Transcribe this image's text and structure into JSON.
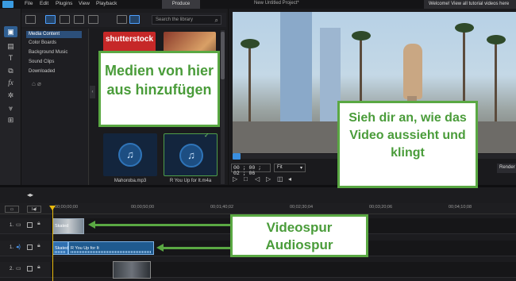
{
  "titlebar": {
    "menu": [
      "File",
      "Edit",
      "Plugins",
      "View",
      "Playback"
    ],
    "produce_label": "Produce",
    "project_title": "New Untitled Project*",
    "welcome_text": "Welcome! View all tutorial videos here"
  },
  "left_toolbar": {
    "tools": [
      "media-room",
      "pip-room",
      "title-room",
      "transition-room",
      "effect-room",
      "particle-room",
      "audio-mixing-room",
      "subtitle-room"
    ]
  },
  "media_room": {
    "search_placeholder": "Search the library",
    "categories": [
      "Media Content",
      "Color Boards",
      "Background Music",
      "Sound Clips",
      "Downloaded"
    ],
    "selected_category": "Media Content",
    "shutterstock_logo": "shutterstock",
    "items": [
      {
        "name": "Mahoroba.mp3",
        "type": "audio"
      },
      {
        "name": "R You Up for It.m4a",
        "type": "audio",
        "in_use": true
      }
    ]
  },
  "callouts": {
    "add_media": "Medien von hier aus hinzufügen",
    "preview": "Sieh dir an, wie das Video aussieht und klingt",
    "video_track": "Videospur",
    "audio_track": "Audiospur"
  },
  "preview": {
    "timecode": "00 ; 00 ; 02 ; 06",
    "zoom": "Fit",
    "render_label": "Render"
  },
  "timeline": {
    "ruler_labels": [
      "00;00;00;00",
      "00;00;50;00",
      "00;01;40;02",
      "00;02;30;04",
      "00;03;20;06",
      "00;04;10;08"
    ],
    "tracks": [
      {
        "number": "1.",
        "kind": "video"
      },
      {
        "number": "1.",
        "kind": "audio"
      },
      {
        "number": "2.",
        "kind": "video"
      }
    ],
    "clips": {
      "video_clip_label": "Skated",
      "audio_clip_a_label": "Skated",
      "audio_clip_b_label": "R You Up for It"
    }
  },
  "colors": {
    "accent": "#3a8fe0",
    "callout_green": "#5aa843",
    "playhead": "#e8b90c"
  }
}
